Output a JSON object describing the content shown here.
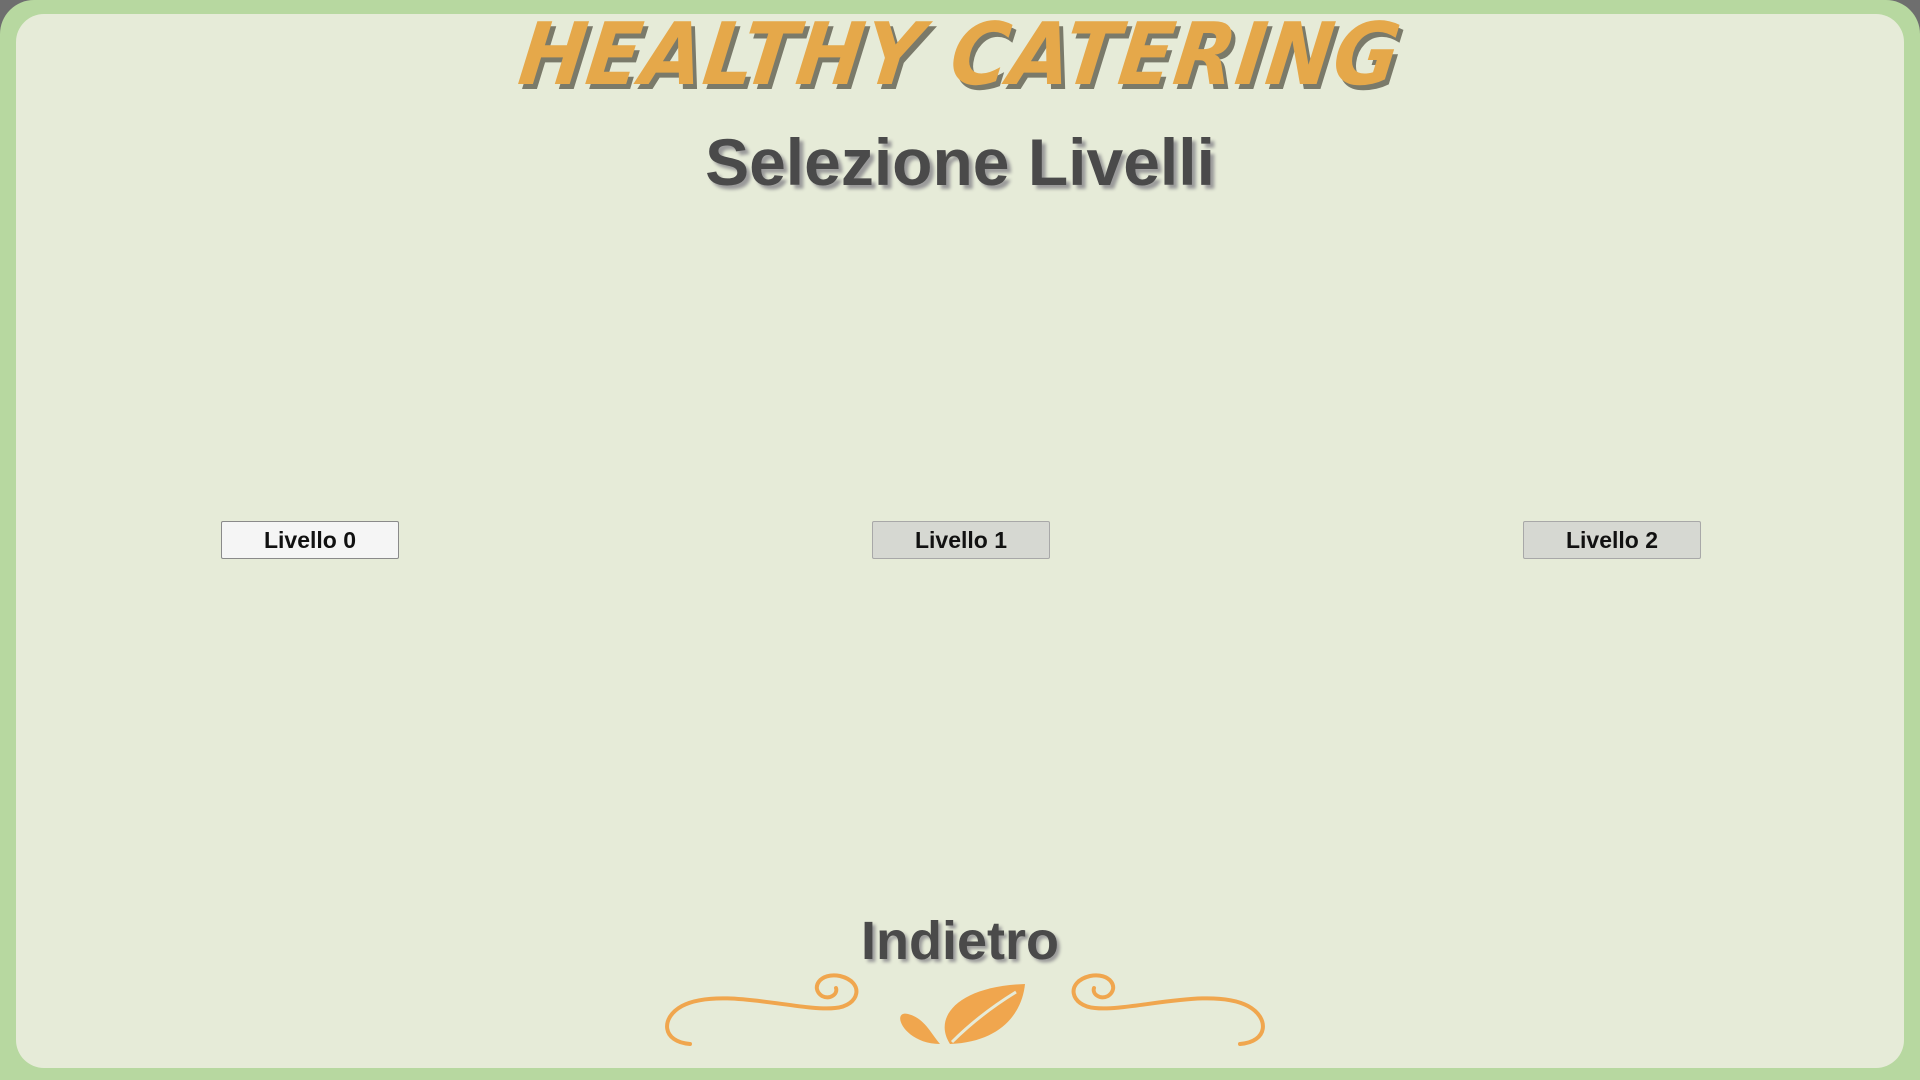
{
  "header": {
    "brand": "HEALTHY CATERING",
    "subtitle": "Selezione Livelli"
  },
  "levels": [
    {
      "label": "Livello 0",
      "selected": true
    },
    {
      "label": "Livello 1",
      "selected": false
    },
    {
      "label": "Livello 2",
      "selected": false
    }
  ],
  "footer": {
    "back_label": "Indietro"
  },
  "colors": {
    "frame": "#b7d8a0",
    "panel": "#e6ebd8",
    "accent": "#e5a84a",
    "text": "#4a4a4a"
  },
  "icons": {
    "ornament": "leaf-swirl-ornament-icon"
  }
}
